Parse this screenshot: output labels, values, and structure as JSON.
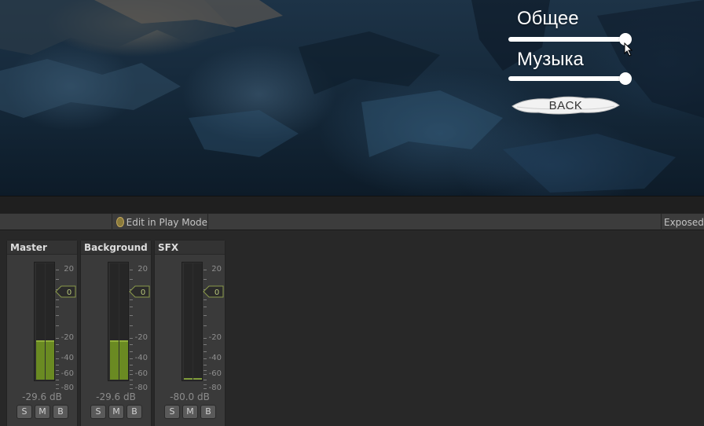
{
  "game_ui": {
    "general_label": "Общее",
    "general_value": 1.0,
    "music_label": "Музыка",
    "music_value": 1.0,
    "back_label": "BACK"
  },
  "toolbar": {
    "edit_in_play_mode_label": "Edit in Play Mode",
    "exposed_params_label": "Exposed Parameters"
  },
  "mixer": {
    "scale_labels": [
      "20",
      "0",
      "-20",
      "-40",
      "-60",
      "-80"
    ],
    "fader_value_label": "0",
    "strips": [
      {
        "name": "Master",
        "level_db": "-29.6 dB",
        "meter_level": 0.34,
        "solo": "S",
        "mute": "M",
        "bypass": "B"
      },
      {
        "name": "Background",
        "level_db": "-29.6 dB",
        "meter_level": 0.34,
        "solo": "S",
        "mute": "M",
        "bypass": "B"
      },
      {
        "name": "SFX",
        "level_db": "-80.0 dB",
        "meter_level": 0.0,
        "solo": "S",
        "mute": "M",
        "bypass": "B"
      }
    ]
  },
  "colors": {
    "meter_green": "#6a8a22",
    "fader_outline": "#8a9a4a",
    "editor_bg": "#282828",
    "toolbar_bg": "#3c3c3c"
  }
}
